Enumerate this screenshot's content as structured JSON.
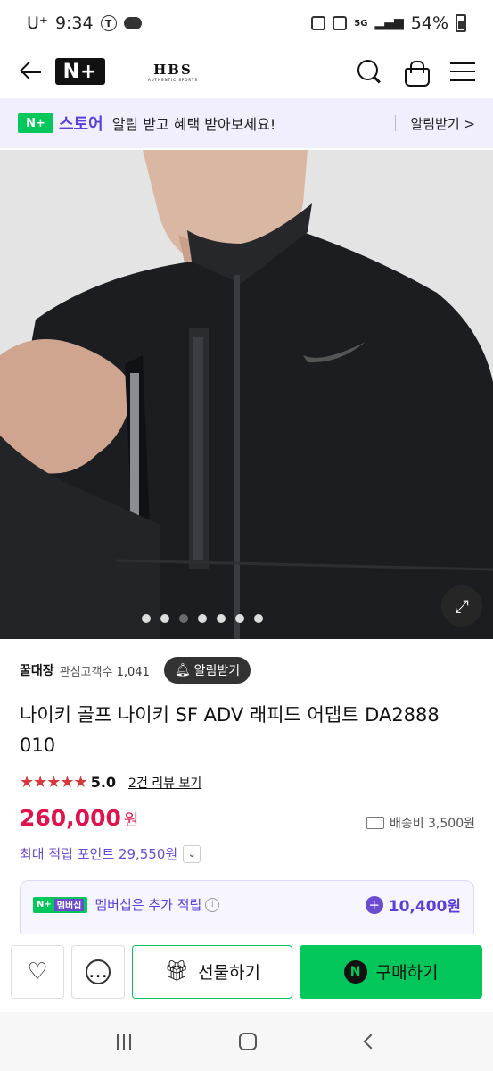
{
  "status_bar": {
    "carrier": "U⁺",
    "time": "9:34",
    "battery": "54%",
    "net": "5G"
  },
  "header": {
    "logo": "N+",
    "brand": "HBS",
    "brand_sub": "AUTHENTIC SPORTS"
  },
  "banner": {
    "badge": "N+",
    "store": "스토어",
    "message": "알림 받고 혜택 받아보세요!",
    "alarm_link": "알림받기 >"
  },
  "hero": {
    "dot_count": 7,
    "active_dot": 2
  },
  "seller": {
    "name": "꿀대장",
    "fans_label": "관심고객수",
    "fans_count": "1,041",
    "alarm_button": "알림받기"
  },
  "product": {
    "title": "나이키 골프 나이키 SF ADV 래피드 어댑트 DA2888 010",
    "stars": "★★★★★",
    "rating": 5.0,
    "rating_text": "5.0",
    "reviews": "2건 리뷰 보기",
    "price": "260,000",
    "currency": "원",
    "shipping": "배송비 3,500원",
    "points": "최대 적립 포인트 29,550원"
  },
  "membership": {
    "badge": "N+",
    "badge_tag": "멤버십",
    "desc": "멤버십은 추가 적립",
    "amount": "10,400원"
  },
  "actions": {
    "gift": "선물하기",
    "buy": "구매하기",
    "buy_logo": "N"
  },
  "colors": {
    "naver_green": "#03c75a",
    "price_red": "#e0144c",
    "purple": "#5a3fdb",
    "star_red": "#d6383b"
  }
}
